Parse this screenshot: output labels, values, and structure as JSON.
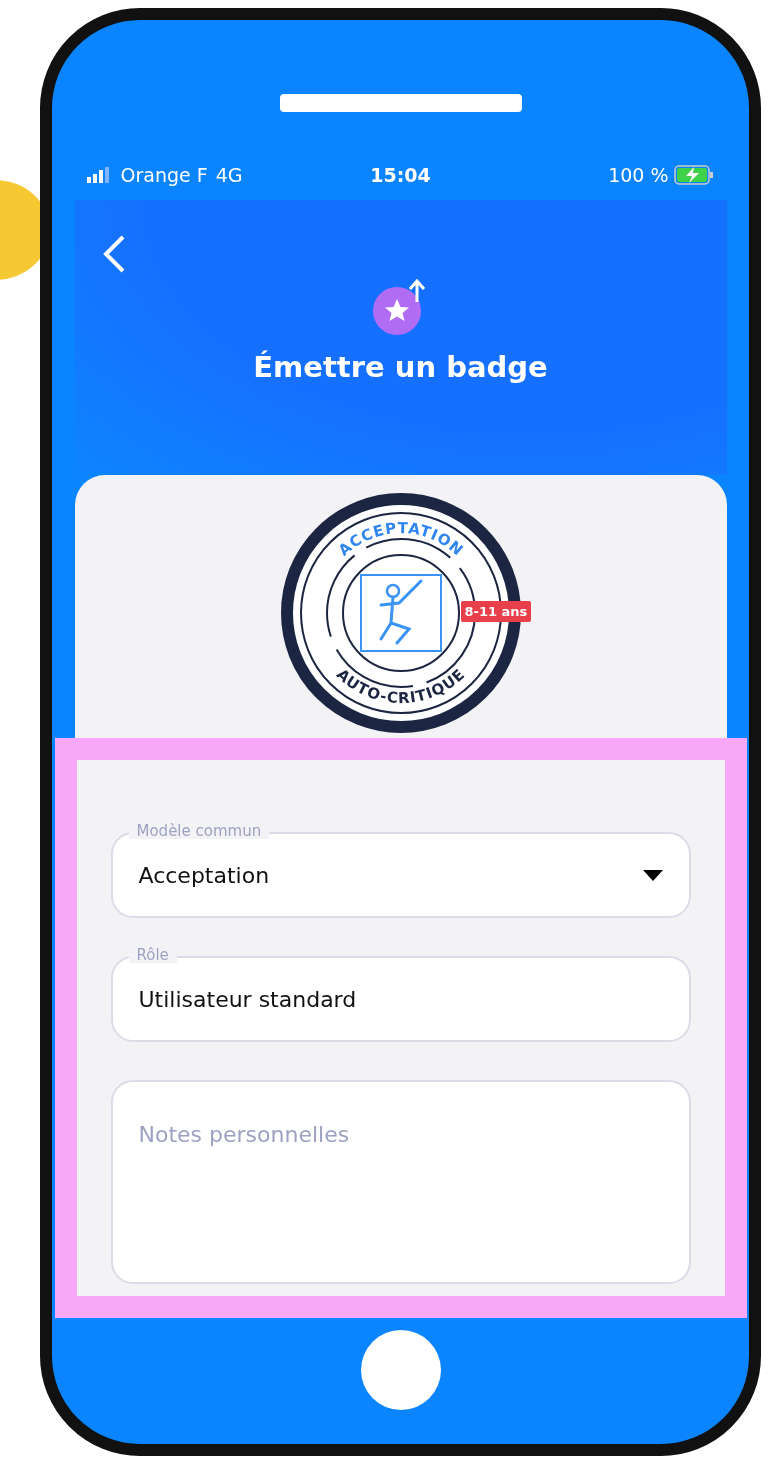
{
  "status_bar": {
    "carrier": "Orange F",
    "network": "4G",
    "time": "15:04",
    "battery": "100 %"
  },
  "header": {
    "title": "Émettre un badge"
  },
  "badge": {
    "top_text": "ACCEPTATION",
    "bottom_text": "AUTO-CRITIQUE",
    "age_tag": "8-11 ans"
  },
  "form": {
    "fields": [
      {
        "kind": "dropdown",
        "label": "Modèle commun",
        "value": "Acceptation"
      },
      {
        "kind": "text",
        "label": "Rôle",
        "value": "Utilisateur standard"
      },
      {
        "kind": "textarea",
        "placeholder": "Notes personnelles"
      }
    ]
  }
}
